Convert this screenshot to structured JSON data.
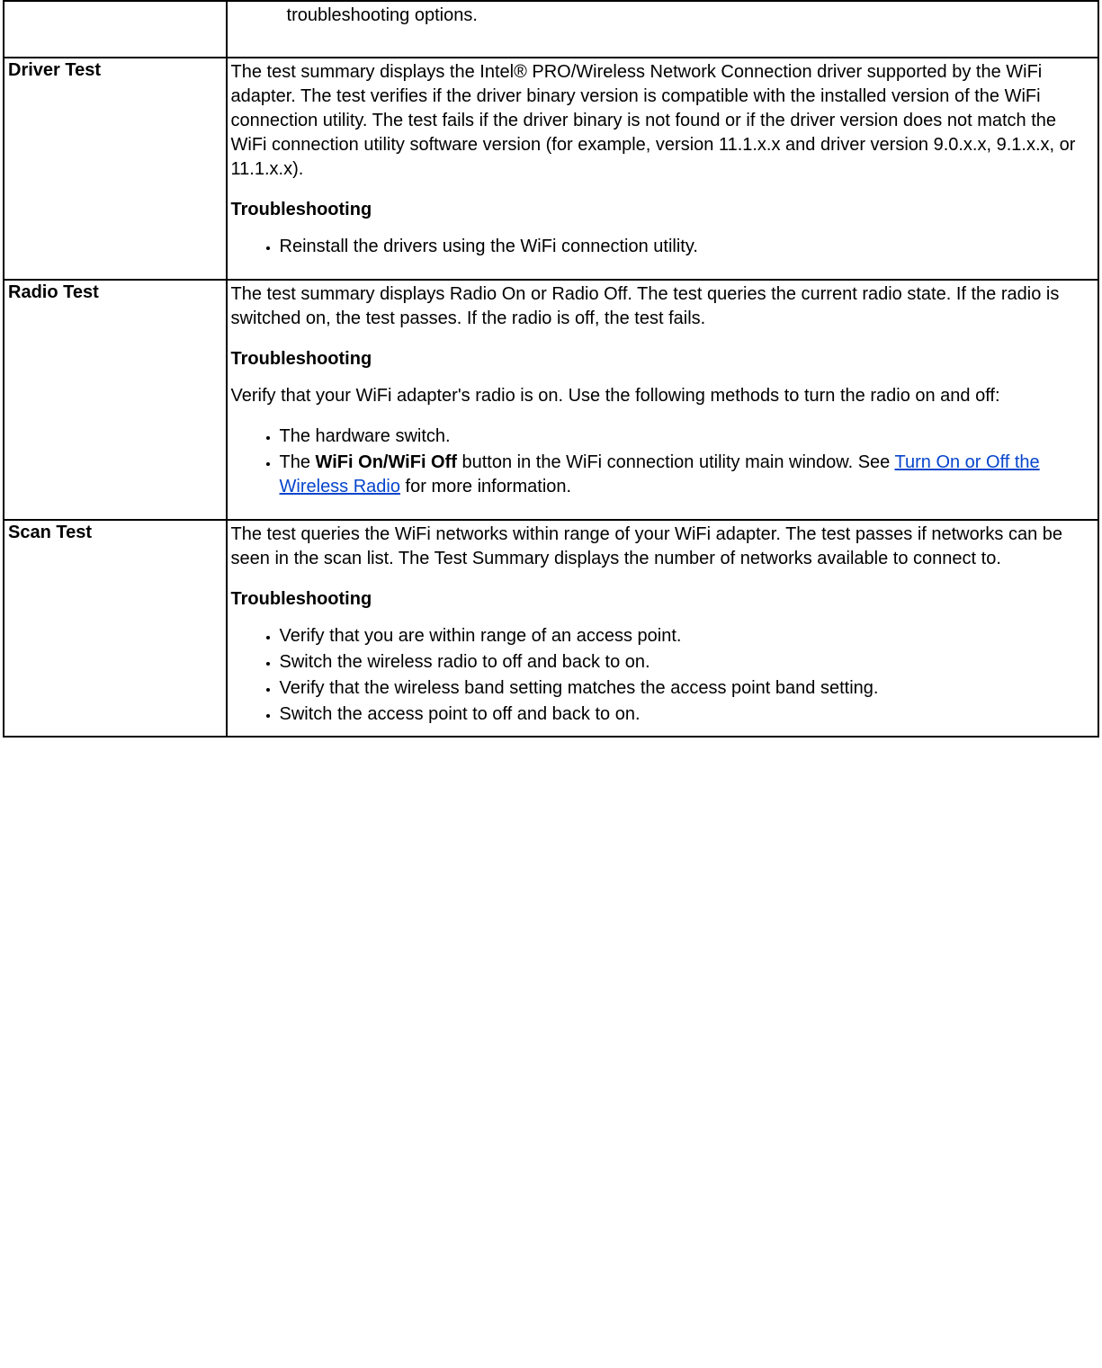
{
  "rows": {
    "partial": {
      "bullet_text": "troubleshooting options."
    },
    "driver": {
      "label": "Driver Test",
      "desc": "The test summary displays the Intel® PRO/Wireless Network Connection driver supported by the WiFi adapter. The test verifies if the driver binary version is compatible with the installed version of the WiFi connection utility. The test fails if the driver binary is not found or if the driver version does not match the WiFi connection utility software version (for example, version 11.1.x.x and driver version 9.0.x.x, 9.1.x.x, or 11.1.x.x).",
      "ts_head": "Troubleshooting",
      "bullets": [
        "Reinstall the drivers using the WiFi connection utility."
      ]
    },
    "radio": {
      "label": "Radio Test",
      "desc": "The test summary displays Radio On or Radio Off. The test queries the current radio state. If the radio is switched on, the test passes. If the radio is off, the test fails.",
      "ts_head": "Troubleshooting",
      "intro": "Verify that your WiFi adapter's radio is on. Use the following methods to turn the radio on and off:",
      "bullets": {
        "b1": "The hardware switch.",
        "b2_pre": "The ",
        "b2_strong": "WiFi On/WiFi Off",
        "b2_mid": " button in the WiFi connection utility main window. See ",
        "b2_link": "Turn On or Off the Wireless Radio",
        "b2_post": " for more information."
      }
    },
    "scan": {
      "label": "Scan Test",
      "desc": "The test queries the WiFi networks within range of your WiFi adapter. The test passes if networks can be seen in the scan list. The Test Summary displays the number of networks available to connect to.",
      "ts_head": "Troubleshooting",
      "bullets": [
        "Verify that you are within range of an access point.",
        "Switch the wireless radio to off and back to on.",
        "Verify that the wireless band setting matches the access point band setting.",
        "Switch the access point to off and back to on."
      ]
    }
  }
}
